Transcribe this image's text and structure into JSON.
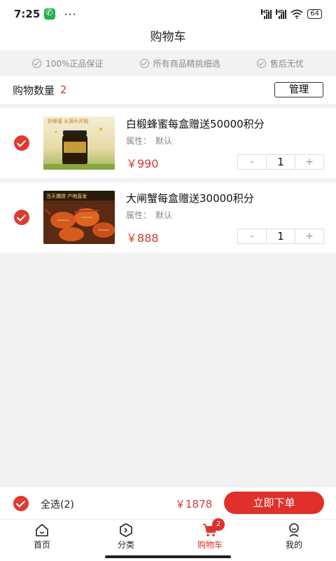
{
  "status_bar": {
    "time": "7:25",
    "dots": "···",
    "hd1": "HD",
    "hd2": "HD",
    "battery": "64"
  },
  "header": {
    "title": "购物车"
  },
  "guarantees": [
    {
      "label": "100%正品保证"
    },
    {
      "label": "所有商品精挑细选"
    },
    {
      "label": "售后无忧"
    }
  ],
  "count_bar": {
    "label": "购物数量",
    "count": "2",
    "manage_label": "管理"
  },
  "items": [
    {
      "title": "白椴蜂蜜每盒赠送50000积分",
      "attr_label": "属性：",
      "attr_value": "默认",
      "price": "￥990",
      "qty": "1",
      "minus": "-",
      "plus": "+",
      "image_caption": "好蜂蜜 从源头开始"
    },
    {
      "title": "大闸蟹每盒赠送30000积分",
      "attr_label": "属性：",
      "attr_value": "默认",
      "price": "￥888",
      "qty": "1",
      "minus": "-",
      "plus": "+",
      "image_caption": "当天捕捞 产地直发"
    }
  ],
  "bottom_bar": {
    "select_all": "全选(2)",
    "total": "￥1878",
    "order_label": "立即下单"
  },
  "tabs": [
    {
      "label": "首页",
      "icon": "home-icon"
    },
    {
      "label": "分类",
      "icon": "category-icon"
    },
    {
      "label": "购物车",
      "icon": "cart-icon",
      "badge": "2"
    },
    {
      "label": "我的",
      "icon": "profile-icon"
    }
  ],
  "colors": {
    "accent": "#e0302b",
    "price": "#d43a30",
    "background": "#f2f2f2"
  }
}
